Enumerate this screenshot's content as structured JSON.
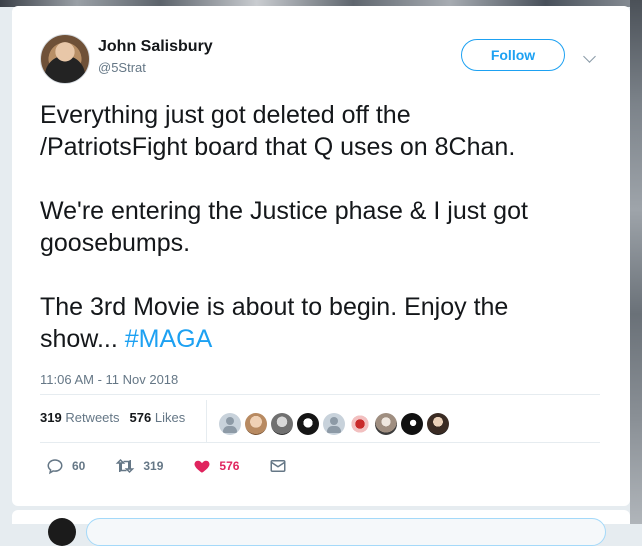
{
  "tweet": {
    "author_name": "John Salisbury",
    "author_handle": "@5Strat",
    "follow_label": "Follow",
    "text_line1": "Everything just got deleted off the\n/PatriotsFight board that Q uses on 8Chan.\n\nWe're entering the Justice phase & I just got\ngoosebumps.\n\nThe 3rd Movie is about to begin. Enjoy the\nshow... ",
    "hashtag": "#MAGA",
    "timestamp": "11:06 AM - 11 Nov 2018",
    "retweets_count": "319",
    "retweets_label": "Retweets",
    "likes_count": "576",
    "likes_label": "Likes",
    "actions": {
      "reply_count": "60",
      "retweet_count": "319",
      "like_count": "576"
    }
  },
  "icons": {
    "more": "chevron-down-icon",
    "reply": "reply-icon",
    "retweet": "retweet-icon",
    "like": "heart-icon",
    "dm": "envelope-icon"
  },
  "colors": {
    "accent": "#1da1f2",
    "like": "#e0245e",
    "muted": "#657786"
  }
}
